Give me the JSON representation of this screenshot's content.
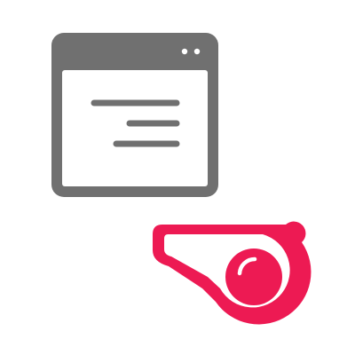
{
  "icons": {
    "browser_window": {
      "name": "browser-window-icon",
      "color": "#707070"
    },
    "whistle": {
      "name": "whistle-icon",
      "color": "#ED1A53"
    }
  }
}
